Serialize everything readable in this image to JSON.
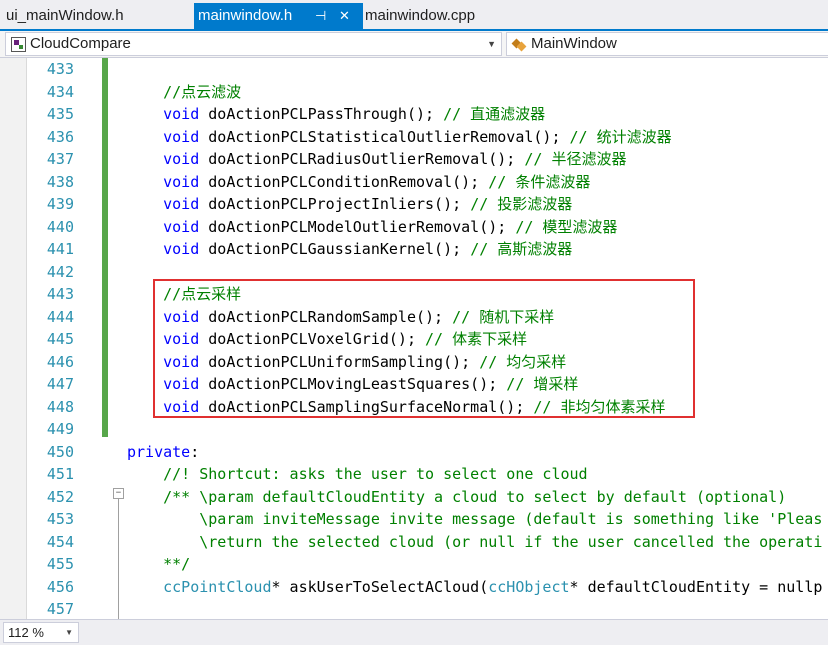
{
  "tabs": [
    {
      "label": "ui_mainWindow.h",
      "active": false
    },
    {
      "label": "mainwindow.h",
      "active": true
    },
    {
      "label": "mainwindow.cpp",
      "active": false
    }
  ],
  "tab_icons": {
    "pin": "⊣",
    "close": "✕"
  },
  "nav": {
    "project": "CloudCompare",
    "scope": "MainWindow"
  },
  "zoom": "112 %",
  "colors": {
    "accent": "#007acc",
    "keyword": "#0000ff",
    "comment": "#008000",
    "type": "#2b91af",
    "highlight_box": "#e03030"
  },
  "lines": [
    {
      "num": "433",
      "tokens": []
    },
    {
      "num": "434",
      "tokens": [
        [
          "cm",
          "    //点云滤波"
        ]
      ]
    },
    {
      "num": "435",
      "tokens": [
        [
          "kw",
          "    void"
        ],
        [
          "fn",
          " doActionPCLPassThrough(); "
        ],
        [
          "cm",
          "// 直通滤波器"
        ]
      ]
    },
    {
      "num": "436",
      "tokens": [
        [
          "kw",
          "    void"
        ],
        [
          "fn",
          " doActionPCLStatisticalOutlierRemoval(); "
        ],
        [
          "cm",
          "// 统计滤波器"
        ]
      ]
    },
    {
      "num": "437",
      "tokens": [
        [
          "kw",
          "    void"
        ],
        [
          "fn",
          " doActionPCLRadiusOutlierRemoval(); "
        ],
        [
          "cm",
          "// 半径滤波器"
        ]
      ]
    },
    {
      "num": "438",
      "tokens": [
        [
          "kw",
          "    void"
        ],
        [
          "fn",
          " doActionPCLConditionRemoval(); "
        ],
        [
          "cm",
          "// 条件滤波器"
        ]
      ]
    },
    {
      "num": "439",
      "tokens": [
        [
          "kw",
          "    void"
        ],
        [
          "fn",
          " doActionPCLProjectInliers(); "
        ],
        [
          "cm",
          "// 投影滤波器"
        ]
      ]
    },
    {
      "num": "440",
      "tokens": [
        [
          "kw",
          "    void"
        ],
        [
          "fn",
          " doActionPCLModelOutlierRemoval(); "
        ],
        [
          "cm",
          "// 模型滤波器"
        ]
      ]
    },
    {
      "num": "441",
      "tokens": [
        [
          "kw",
          "    void"
        ],
        [
          "fn",
          " doActionPCLGaussianKernel(); "
        ],
        [
          "cm",
          "// 高斯滤波器"
        ]
      ]
    },
    {
      "num": "442",
      "tokens": []
    },
    {
      "num": "443",
      "tokens": [
        [
          "cm",
          "    //点云采样"
        ]
      ]
    },
    {
      "num": "444",
      "tokens": [
        [
          "kw",
          "    void"
        ],
        [
          "fn",
          " doActionPCLRandomSample(); "
        ],
        [
          "cm",
          "// 随机下采样"
        ]
      ]
    },
    {
      "num": "445",
      "tokens": [
        [
          "kw",
          "    void"
        ],
        [
          "fn",
          " doActionPCLVoxelGrid(); "
        ],
        [
          "cm",
          "// 体素下采样"
        ]
      ]
    },
    {
      "num": "446",
      "tokens": [
        [
          "kw",
          "    void"
        ],
        [
          "fn",
          " doActionPCLUniformSampling(); "
        ],
        [
          "cm",
          "// 均匀采样"
        ]
      ]
    },
    {
      "num": "447",
      "tokens": [
        [
          "kw",
          "    void"
        ],
        [
          "fn",
          " doActionPCLMovingLeastSquares(); "
        ],
        [
          "cm",
          "// 增采样"
        ]
      ]
    },
    {
      "num": "448",
      "tokens": [
        [
          "kw",
          "    void"
        ],
        [
          "fn",
          " doActionPCLSamplingSurfaceNormal(); "
        ],
        [
          "cm",
          "// 非均匀体素采样"
        ]
      ]
    },
    {
      "num": "449",
      "tokens": []
    },
    {
      "num": "450",
      "tokens": [
        [
          "kw",
          "private"
        ],
        [
          "fn",
          ":"
        ]
      ]
    },
    {
      "num": "451",
      "tokens": [
        [
          "cm",
          "    //! Shortcut: asks the user to select one cloud"
        ]
      ]
    },
    {
      "num": "452",
      "tokens": [
        [
          "cm",
          "    /** \\param defaultCloudEntity a cloud to select by default (optional)"
        ]
      ]
    },
    {
      "num": "453",
      "tokens": [
        [
          "cm",
          "        \\param inviteMessage invite message (default is something like 'Pleas"
        ]
      ]
    },
    {
      "num": "454",
      "tokens": [
        [
          "cm",
          "        \\return the selected cloud (or null if the user cancelled the operati"
        ]
      ]
    },
    {
      "num": "455",
      "tokens": [
        [
          "cm",
          "    **/"
        ]
      ]
    },
    {
      "num": "456",
      "tokens": [
        [
          "ty",
          "    ccPointCloud"
        ],
        [
          "fn",
          "* askUserToSelectACloud("
        ],
        [
          "ty",
          "ccHObject"
        ],
        [
          "fn",
          "* defaultCloudEntity = nullp"
        ]
      ]
    },
    {
      "num": "457",
      "tokens": []
    }
  ]
}
